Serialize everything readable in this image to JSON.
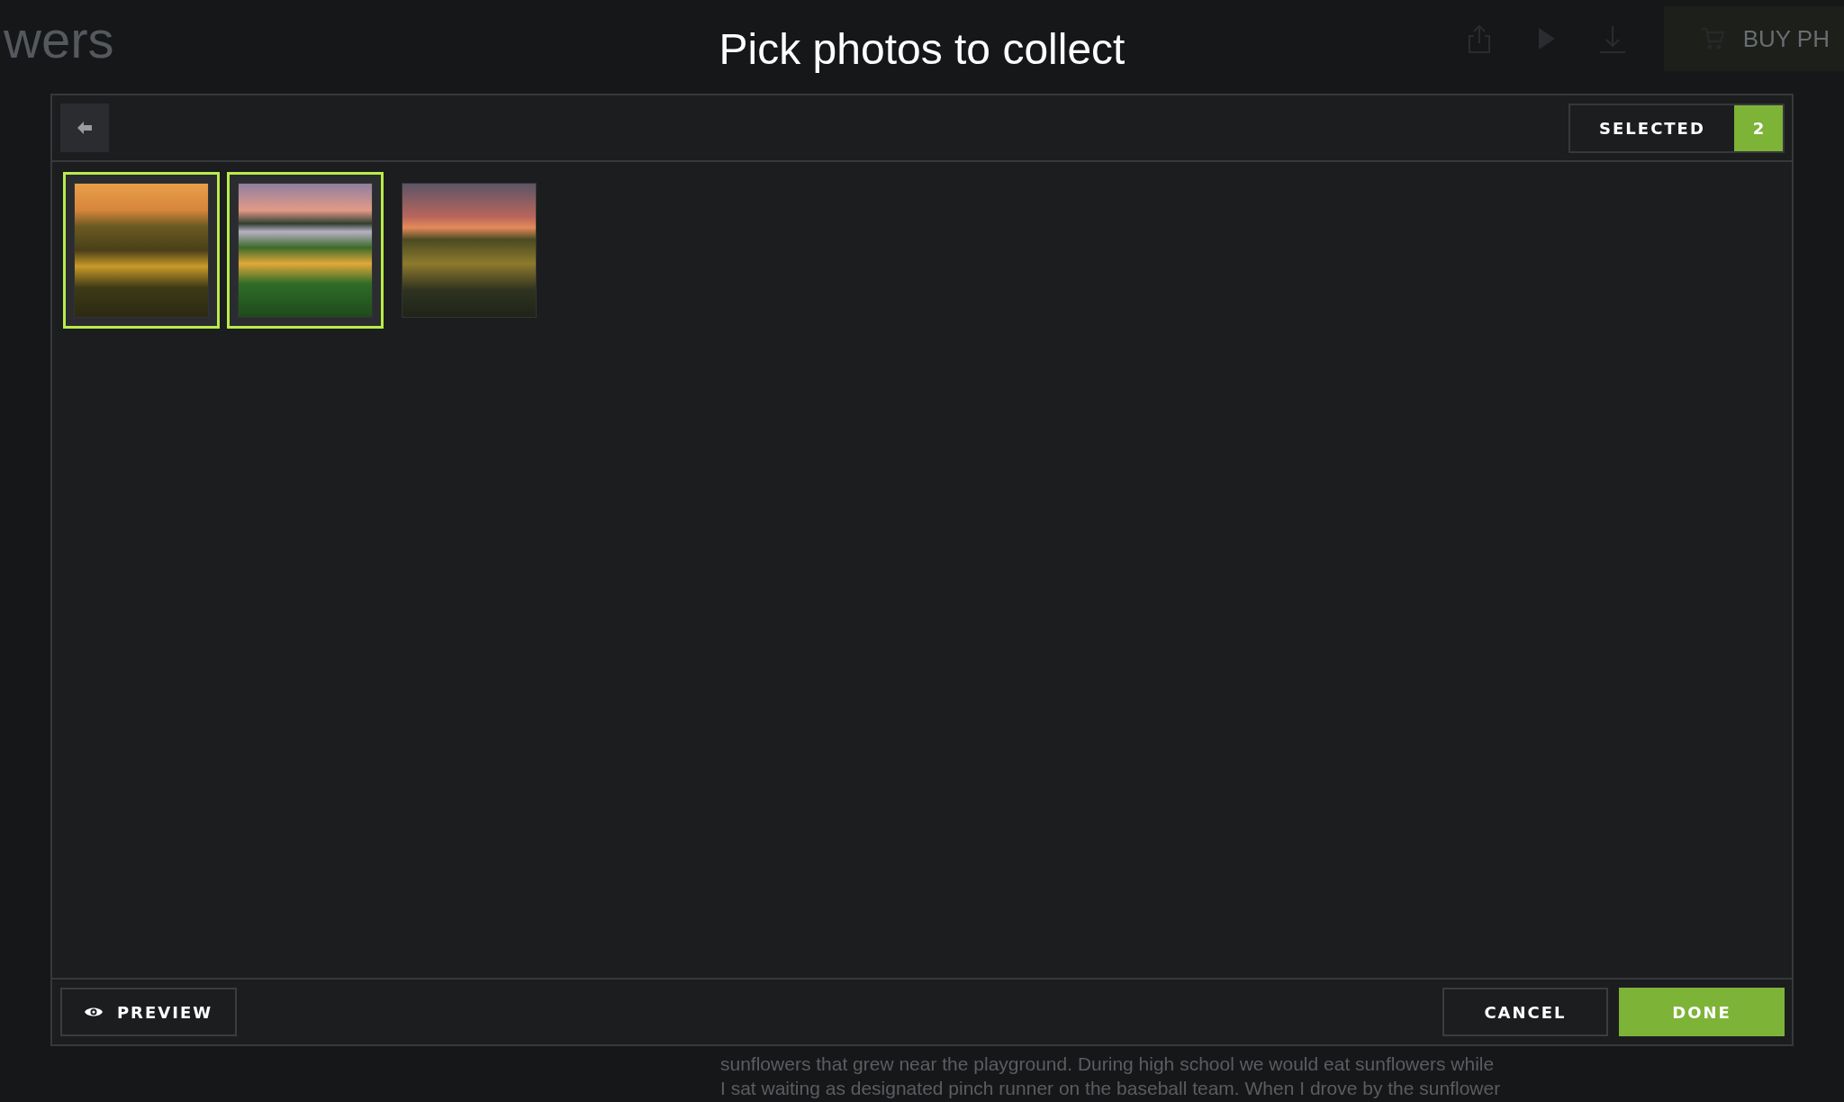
{
  "background": {
    "heading": "wers",
    "toolbar_button": "BUY PH",
    "paragraph_lines": [
      "sunflowers that grew near the playground. During high school we would eat sunflowers while",
      "I sat waiting as designated pinch runner on the baseball team. When I drove by the sunflower"
    ]
  },
  "dialog": {
    "title": "Pick photos to collect",
    "selected_label": "SELECTED",
    "selected_count": "2",
    "photos": [
      {
        "selected": true,
        "kind": "sunflower-field"
      },
      {
        "selected": true,
        "kind": "lake-flowers"
      },
      {
        "selected": false,
        "kind": "dusk-sunflowers"
      }
    ],
    "preview_button": "PREVIEW",
    "cancel_button": "CANCEL",
    "done_button": "DONE"
  }
}
